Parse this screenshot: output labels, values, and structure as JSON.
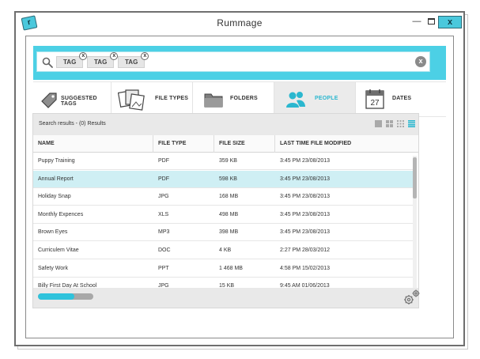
{
  "window": {
    "title": "Rummage",
    "logo_glyph": "r",
    "minimize_glyph": "—",
    "close_glyph": "x"
  },
  "search": {
    "icon": "search-icon",
    "tags": [
      {
        "label": "TAG"
      },
      {
        "label": "TAG"
      },
      {
        "label": "TAG"
      }
    ],
    "tag_remove_glyph": "x",
    "clear_glyph": "x",
    "accent_color": "#4cd0e5"
  },
  "filters": [
    {
      "label": "SUGGESTED TAGS",
      "icon": "tag-icon",
      "active": false
    },
    {
      "label": "FILE TYPES",
      "icon": "file-types-icon",
      "active": false
    },
    {
      "label": "FOLDERS",
      "icon": "folder-icon",
      "active": false
    },
    {
      "label": "PEOPLE",
      "icon": "people-icon",
      "active": true
    },
    {
      "label": "DATES",
      "icon": "calendar-icon",
      "active": false,
      "calendar_day": "27"
    }
  ],
  "results": {
    "summary": "Search results - (0) Results",
    "view_modes": [
      "large-icons-view-icon",
      "medium-icons-view-icon",
      "small-icons-view-icon",
      "list-view-icon"
    ],
    "active_view": "list-view-icon",
    "columns": [
      "NAME",
      "FILE TYPE",
      "FILE SIZE",
      "LAST TIME FILE MODIFIED"
    ],
    "rows": [
      {
        "name": "Puppy Training",
        "type": "PDF",
        "size": "359 KB",
        "modified": "3:45 PM 23/08/2013",
        "selected": false
      },
      {
        "name": "Annual Report",
        "type": "PDF",
        "size": "598 KB",
        "modified": "3:45 PM 23/08/2013",
        "selected": true
      },
      {
        "name": "Holiday Snap",
        "type": "JPG",
        "size": "168 MB",
        "modified": "3:45 PM 23/08/2013",
        "selected": false
      },
      {
        "name": "Monthly Expences",
        "type": "XLS",
        "size": "498 MB",
        "modified": "3:45 PM 23/08/2013",
        "selected": false
      },
      {
        "name": "Brown Eyes",
        "type": "MP3",
        "size": "398 MB",
        "modified": "3:45 PM 23/08/2013",
        "selected": false
      },
      {
        "name": "Curriculem Vitae",
        "type": "DOC",
        "size": "4 KB",
        "modified": "2:27 PM 28/03/2012",
        "selected": false
      },
      {
        "name": "Safety Work",
        "type": "PPT",
        "size": "1 468 MB",
        "modified": "4:58 PM 15/02/2013",
        "selected": false
      },
      {
        "name": "Billy First Day At School",
        "type": "JPG",
        "size": "15 KB",
        "modified": "9:45 AM 01/06/2013",
        "selected": false
      }
    ]
  },
  "footer": {
    "progress": 0.65,
    "settings_icon": "gears-icon"
  }
}
